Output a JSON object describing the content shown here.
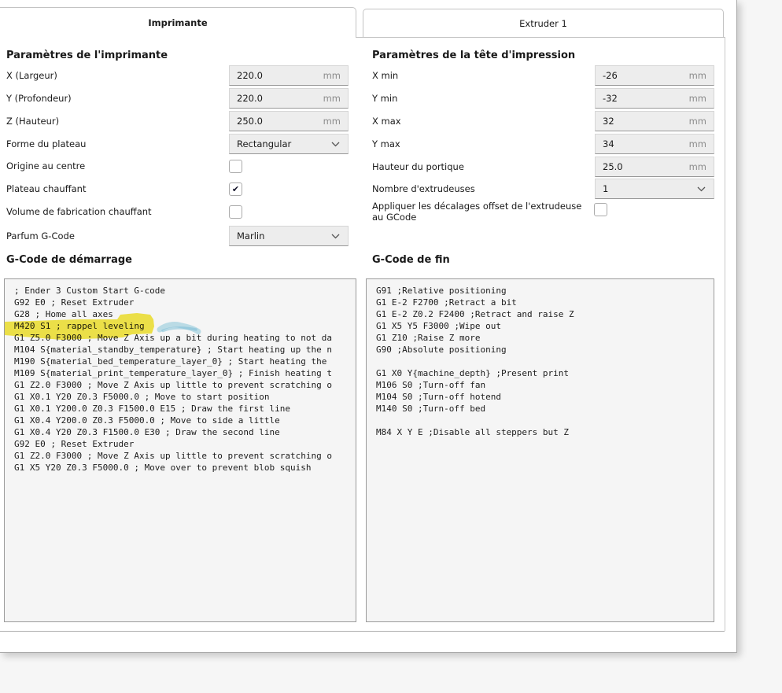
{
  "tabs": {
    "printer": "Imprimante",
    "extruder": "Extruder 1"
  },
  "printer_section": {
    "title": "Paramètres de l'imprimante",
    "fields": {
      "x_width": {
        "label": "X (Largeur)",
        "value": "220.0",
        "unit": "mm"
      },
      "y_depth": {
        "label": "Y (Profondeur)",
        "value": "220.0",
        "unit": "mm"
      },
      "z_height": {
        "label": "Z (Hauteur)",
        "value": "250.0",
        "unit": "mm"
      },
      "bed_shape": {
        "label": "Forme du plateau",
        "value": "Rectangular"
      },
      "origin_center": {
        "label": "Origine au centre",
        "checked": false
      },
      "heated_bed": {
        "label": "Plateau chauffant",
        "checked": true
      },
      "heated_volume": {
        "label": "Volume de fabrication chauffant",
        "checked": false
      },
      "gcode_flavor": {
        "label": "Parfum G-Code",
        "value": "Marlin"
      }
    }
  },
  "printhead_section": {
    "title": "Paramètres de la tête d'impression",
    "fields": {
      "x_min": {
        "label": "X min",
        "value": "-26",
        "unit": "mm"
      },
      "y_min": {
        "label": "Y min",
        "value": "-32",
        "unit": "mm"
      },
      "x_max": {
        "label": "X max",
        "value": "32",
        "unit": "mm"
      },
      "y_max": {
        "label": "Y max",
        "value": "34",
        "unit": "mm"
      },
      "gantry_height": {
        "label": "Hauteur du portique",
        "value": "25.0",
        "unit": "mm"
      },
      "extruder_count": {
        "label": "Nombre d'extrudeuses",
        "value": "1"
      },
      "apply_offsets": {
        "label": "Appliquer les décalages offset de l'extrudeuse au GCode",
        "checked": false
      }
    }
  },
  "start_gcode": {
    "title": "G-Code de démarrage",
    "lines": [
      "; Ender 3 Custom Start G-code",
      "G92 E0 ; Reset Extruder",
      "G28 ; Home all axes",
      "M420 S1 ; rappel leveling",
      "G1 Z5.0 F3000 ; Move Z Axis up a bit during heating to not da",
      "M104 S{material_standby_temperature} ; Start heating up the n",
      "M190 S{material_bed_temperature_layer_0} ; Start heating the",
      "M109 S{material_print_temperature_layer_0} ; Finish heating t",
      "G1 Z2.0 F3000 ; Move Z Axis up little to prevent scratching o",
      "G1 X0.1 Y20 Z0.3 F5000.0 ; Move to start position",
      "G1 X0.1 Y200.0 Z0.3 F1500.0 E15 ; Draw the first line",
      "G1 X0.4 Y200.0 Z0.3 F5000.0 ; Move to side a little",
      "G1 X0.4 Y20 Z0.3 F1500.0 E30 ; Draw the second line",
      "G92 E0 ; Reset Extruder",
      "G1 Z2.0 F3000 ; Move Z Axis up little to prevent scratching o",
      "G1 X5 Y20 Z0.3 F5000.0 ; Move over to prevent blob squish"
    ]
  },
  "end_gcode": {
    "title": "G-Code de fin",
    "lines": [
      "G91 ;Relative positioning",
      "G1 E-2 F2700 ;Retract a bit",
      "G1 E-2 Z0.2 F2400 ;Retract and raise Z",
      "G1 X5 Y5 F3000 ;Wipe out",
      "G1 Z10 ;Raise Z more",
      "G90 ;Absolute positioning",
      "",
      "G1 X0 Y{machine_depth} ;Present print",
      "M106 S0 ;Turn-off fan",
      "M104 S0 ;Turn-off hotend",
      "M140 S0 ;Turn-off bed",
      "",
      "M84 X Y E ;Disable all steppers but Z"
    ]
  },
  "annotations": {
    "highlighted_line": "M420 S1 ; rappel leveling",
    "highlight_color": "#f2e118",
    "scribble_color": "#8fcde2"
  }
}
